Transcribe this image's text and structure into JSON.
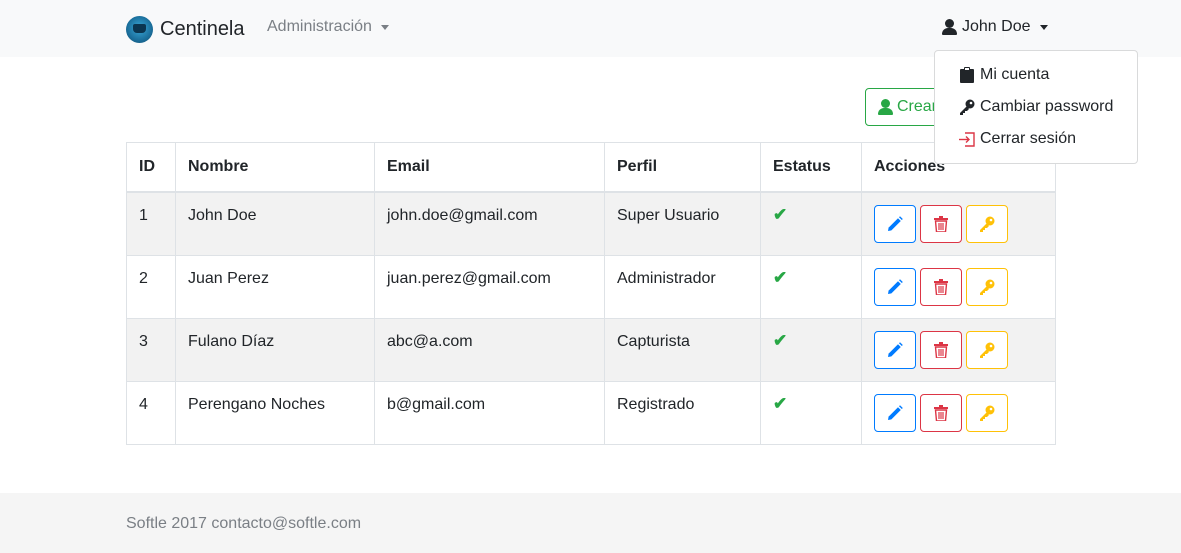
{
  "navbar": {
    "brand": "Centinela",
    "admin_menu": "Administración",
    "user_menu": "John Doe"
  },
  "user_dropdown": {
    "items": [
      {
        "label": "Mi cuenta",
        "icon": "clipboard-icon"
      },
      {
        "label": "Cambiar password",
        "icon": "key-icon"
      },
      {
        "label": "Cerrar sesión",
        "icon": "sign-out-icon"
      }
    ]
  },
  "create_button": {
    "label": "Crear",
    "icon": "user-add-icon"
  },
  "table": {
    "headers": [
      "ID",
      "Nombre",
      "Email",
      "Perfil",
      "Estatus",
      "Acciones"
    ],
    "rows": [
      {
        "id": "1",
        "nombre": "John Doe",
        "email": "john.doe@gmail.com",
        "perfil": "Super Usuario",
        "estatus": "✔"
      },
      {
        "id": "2",
        "nombre": "Juan Perez",
        "email": "juan.perez@gmail.com",
        "perfil": "Administrador",
        "estatus": "✔"
      },
      {
        "id": "3",
        "nombre": "Fulano Díaz",
        "email": "abc@a.com",
        "perfil": "Capturista",
        "estatus": "✔"
      },
      {
        "id": "4",
        "nombre": "Perengano Noches",
        "email": "b@gmail.com",
        "perfil": "Registrado",
        "estatus": "✔"
      }
    ]
  },
  "colors": {
    "primary": "#007bff",
    "danger": "#dc3545",
    "warning": "#ffc107",
    "success": "#28a745"
  },
  "footer": {
    "text": "Softle 2017 contacto@softle.com"
  }
}
